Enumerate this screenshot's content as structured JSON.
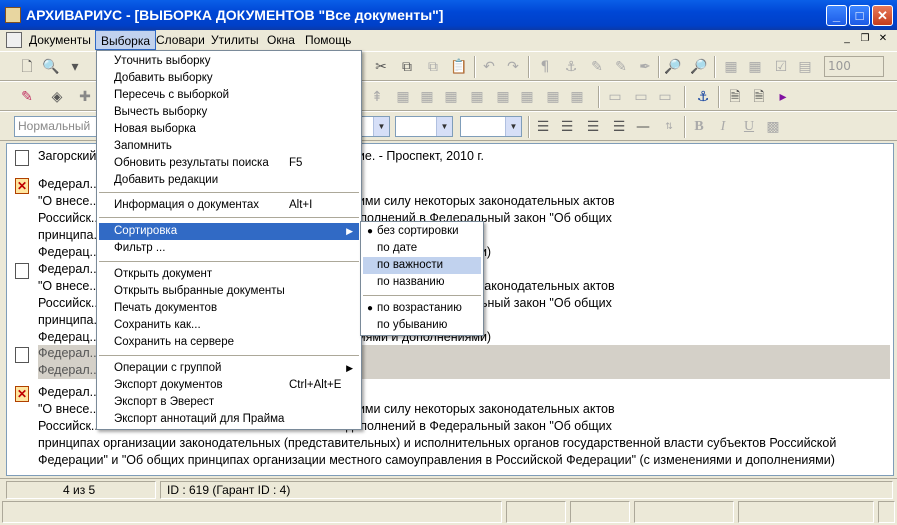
{
  "window": {
    "title": "АРХИВАРИУС - [ВЫБОРКА ДОКУМЕНТОВ \"Все документы\"]",
    "minimize": "_",
    "maximize": "□",
    "close": "✕"
  },
  "menubar": {
    "items": [
      "Документы",
      "Выборка",
      "Словари",
      "Утилиты",
      "Окна",
      "Помощь"
    ],
    "active": "Выборка"
  },
  "toolbar": {
    "style_combo": "Нормальный",
    "zoom_value": "100"
  },
  "documents": [
    {
      "icon": "document-icon",
      "text": "Загорский ... теории и практики: учебно-практич. пособие. - Проспект, 2010 г."
    },
    {
      "icon": "cancelled-document-icon",
      "text": "Федерал...\n\"О внесе... ссийской Федерации и признании утратившими силу некоторых законодательных актов\nРоссийск... льных законов \"О внесении изменений и дополнений в Федеральный закон \"Об общих\nпринципа... тельных органов государственной власти субъектов Российской\nФедерац... ления в Российской Федерации\" (с изменениями и дополнениями)"
    },
    {
      "icon": "document-icon",
      "text": "Федерал...\n\"О внесе... ссийской Федерации и признании утратившими силу некоторых законодательных актов\nРоссийск... льных законов \"О внесении изменений и дополнений в Федеральный закон \"Об общих\nпринципа... тельных органов государственной власти субъектов Российской\nФедерац... ления в Российской Федерации\" (с изменениями и дополнениями)"
    },
    {
      "icon": "document-icon",
      "text": "Федерал...\nФедерал..."
    },
    {
      "icon": "cancelled-document-icon",
      "text": "Федерал...\n\"О внесе... ссийской Федерации и признании утратившими силу некоторых законодательных актов\nРоссийск... льных законов \"О внесении изменений и дополнений в Федеральный закон \"Об общих\nпринципах организации законодательных (представительных) и исполнительных органов государственной власти субъектов Российской\nФедерации\" и \"Об общих принципах организации местного самоуправления в Российской Федерации\" (с изменениями и дополнениями)"
    }
  ],
  "menu": {
    "items": [
      {
        "label": "Уточнить выборку",
        "shortcut": ""
      },
      {
        "label": "Добавить выборку",
        "shortcut": ""
      },
      {
        "label": "Пересечь с выборкой",
        "shortcut": ""
      },
      {
        "label": "Вычесть выборку",
        "shortcut": ""
      },
      {
        "label": "Новая выборка",
        "shortcut": ""
      },
      {
        "label": "Запомнить",
        "shortcut": ""
      },
      {
        "label": "Обновить результаты поиска",
        "shortcut": "F5"
      },
      {
        "label": "Добавить редакции",
        "shortcut": ""
      },
      {
        "label": "Информация о документах",
        "shortcut": "Alt+I"
      },
      {
        "label": "Сортировка",
        "shortcut": ""
      },
      {
        "label": "Фильтр ...",
        "shortcut": ""
      },
      {
        "label": "Открыть документ",
        "shortcut": ""
      },
      {
        "label": "Открыть выбранные документы",
        "shortcut": ""
      },
      {
        "label": "Печать документов",
        "shortcut": ""
      },
      {
        "label": "Сохранить как...",
        "shortcut": ""
      },
      {
        "label": "Сохранить на сервере",
        "shortcut": ""
      },
      {
        "label": "Операции с группой",
        "shortcut": ""
      },
      {
        "label": "Экспорт документов",
        "shortcut": "Ctrl+Alt+E"
      },
      {
        "label": "Экспорт в Эверест",
        "shortcut": ""
      },
      {
        "label": "Экспорт аннотаций для Прайма",
        "shortcut": ""
      }
    ]
  },
  "submenu": {
    "items": [
      "без сортировки",
      "по дате",
      "по важности",
      "по названию",
      "по возрастанию",
      "по убыванию"
    ],
    "checked": [
      "без сортировки",
      "по возрастанию"
    ],
    "highlighted": "по важности"
  },
  "status": {
    "position": "4 из 5",
    "id_info": "ID : 619 (Гарант ID : 4)"
  }
}
